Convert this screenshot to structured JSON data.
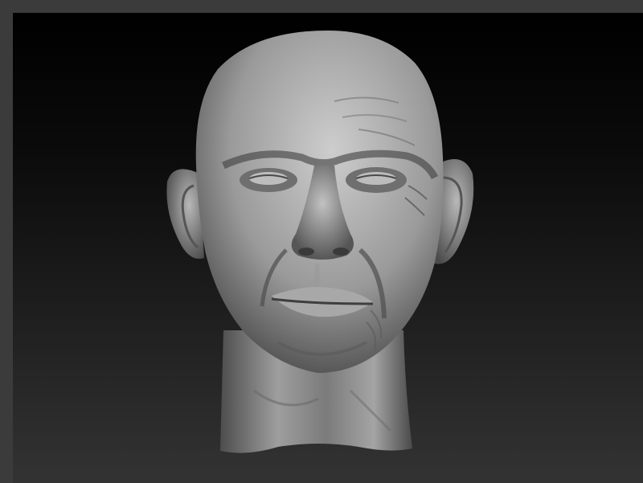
{
  "viewport": {
    "background_top": "#000000",
    "background_bottom": "#333333",
    "border_color": "#3b3b3b"
  },
  "model": {
    "icon": "sculpted-head-icon",
    "material_light": "#c9c9c9",
    "material_mid": "#8e8e8e",
    "material_dark": "#2e2e2e"
  }
}
